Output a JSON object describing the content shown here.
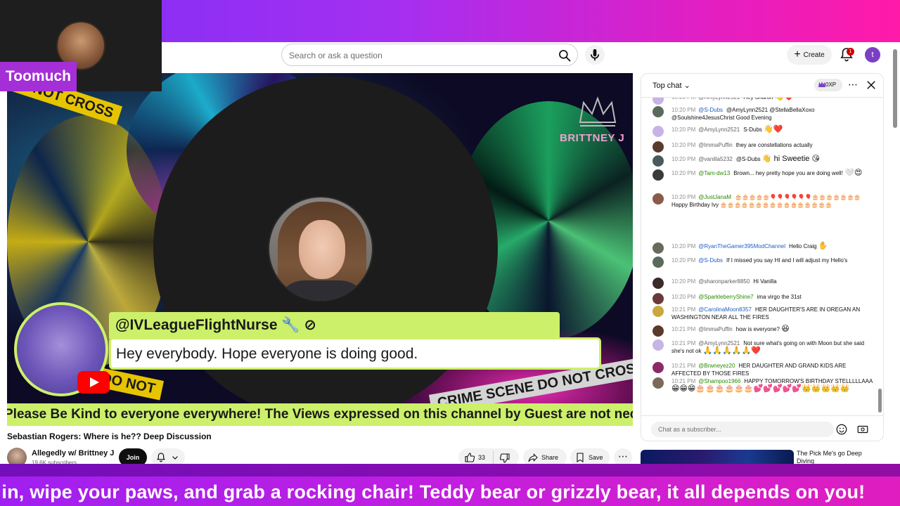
{
  "colors": {
    "top_band": "#a62ff0",
    "bottom_band": "#c21ee0",
    "name_tag": "#a42fd6",
    "overlay_lime": "#ccf06a",
    "join_button": "#0f0f0f",
    "notification_badge": "#cc0000"
  },
  "overlay": {
    "cam_name": "Toomuch",
    "ticker": "n in, wipe your paws, and grab a rocking chair! Teddy bear or grizzly bear, it all depends on you!"
  },
  "header": {
    "search_placeholder": "Search or ask a question",
    "create_label": "Create",
    "notification_count": "1",
    "avatar_initial": "t"
  },
  "video": {
    "watermark": "BRITTNEY J",
    "tape_text": "DO NOT CROSS",
    "tape_text_2": "CRIME SCENE DO NOT CROSS",
    "tape_text_3": "SCENE DO NOT",
    "comment_author": "@IVLeagueFlightNurse",
    "comment_text": "Hey everybody. Hope everyone is doing good.",
    "marquee": "Please Be Kind to everyone everywhere! The Views expressed on this channel by Guest are not nece"
  },
  "below": {
    "title": "Sebastian Rogers: Where is he?? Deep Discussion",
    "channel": "Allegedly w/ Brittney J",
    "subscribers": "19.6K subscribers",
    "join_label": "Join",
    "likes": "33",
    "share_label": "Share",
    "save_label": "Save"
  },
  "chat": {
    "tab_label": "Top chat",
    "xp_label": "0XP",
    "input_placeholder": "Chat as a subscriber...",
    "messages": [
      {
        "time": "10:20 PM",
        "author": "@AmyLynn2521",
        "text": "Hey Sharon",
        "emoji": "👋❤️",
        "color": "#c7b3e6"
      },
      {
        "time": "10:20 PM",
        "author": "@S-Dubs",
        "text": "@AmyLynn2521 @StellaBellaXoxo @Soulshine4JesusChrist Good Evening",
        "emoji": "",
        "color": "#5b6b5b"
      },
      {
        "time": "10:20 PM",
        "author": "@AmyLynn2521",
        "text": "S-Dubs",
        "emoji": "👋❤️",
        "color": "#c7b3e6"
      },
      {
        "time": "10:20 PM",
        "author": "@ImmaPuffin",
        "text": "they are constellations actually",
        "emoji": "",
        "color": "#5a3a2a"
      },
      {
        "time": "10:20 PM",
        "author": "@vanilla5232",
        "text": "@S-Dubs",
        "emoji": "👋 hi Sweetie 😘",
        "color": "#4a5a5a"
      },
      {
        "time": "10:20 PM",
        "author": "@Tam-dw13",
        "text": "Brown... hey pretty hope you are doing well!",
        "emoji": "🤍😍",
        "color": "#3a3a3a"
      },
      {
        "time": "10:20 PM",
        "author": "@JustJanaM",
        "text": "🎂🎂🎂🎂🎂🎈🎈🎈🎈🎈🎈🎂🎂🎂🎂🎂🎂🎂 Happy Birthday Ivy 🎂🎂🎂🎂🎂🎂🎂🎂🎂🎂🎂🎂🎂🎂🎂🎂",
        "emoji": "",
        "color": "#8a5a4a"
      },
      {
        "time": "10:20 PM",
        "author": "@RyanTheGamer395ModChannel",
        "text": "Hello Craig",
        "emoji": "✋",
        "color": "#6a6a5a"
      },
      {
        "time": "10:20 PM",
        "author": "@S-Dubs",
        "text": "If I missed you say HI and I will adjust my Hello's",
        "emoji": "",
        "color": "#5b6b5b"
      },
      {
        "time": "10:20 PM",
        "author": "@sharonparker8850",
        "text": "Hi Vanilla",
        "emoji": "",
        "color": "#3a2a2a"
      },
      {
        "time": "10:20 PM",
        "author": "@SparkleberryShine7",
        "text": "ima virgo the 31st",
        "emoji": "",
        "color": "#6a3a3a"
      },
      {
        "time": "10:21 PM",
        "author": "@CarolinaMoon8357",
        "text": "HER DAUGHTER'S ARE IN OREGAN AN WASHINGTON NEAR ALL THE FIRES",
        "emoji": "",
        "color": "#c9a840"
      },
      {
        "time": "10:21 PM",
        "author": "@ImmaPuffin",
        "text": "how is everyone?",
        "emoji": "😆",
        "color": "#5a3a2a"
      },
      {
        "time": "10:21 PM",
        "author": "@AmyLynn2521",
        "text": "Not sure what's going on with Moon but she said she's not ok",
        "emoji": "🙏🙏🙏🙏🙏❤️",
        "color": "#c7b3e6"
      },
      {
        "time": "10:21 PM",
        "author": "@Brwneyez20",
        "text": "HER DAUGHTER AND GRAND KIDS ARE AFFECTED BY THOSE FIRES",
        "emoji": "",
        "color": "#8a2a6a"
      },
      {
        "time": "10:21 PM",
        "author": "@Shampoo1966",
        "text": "HAPPY TOMORROW'S BIRTHDAY STELLLLLAAA",
        "emoji": "😁😁😁🎂🎂🎂🎂🎂🎂💕💕💕💕💕👑👑👑👑👑",
        "color": "#7a6a5a"
      }
    ]
  },
  "recommended": {
    "title": "The Pick Me's go Deep Diving"
  }
}
